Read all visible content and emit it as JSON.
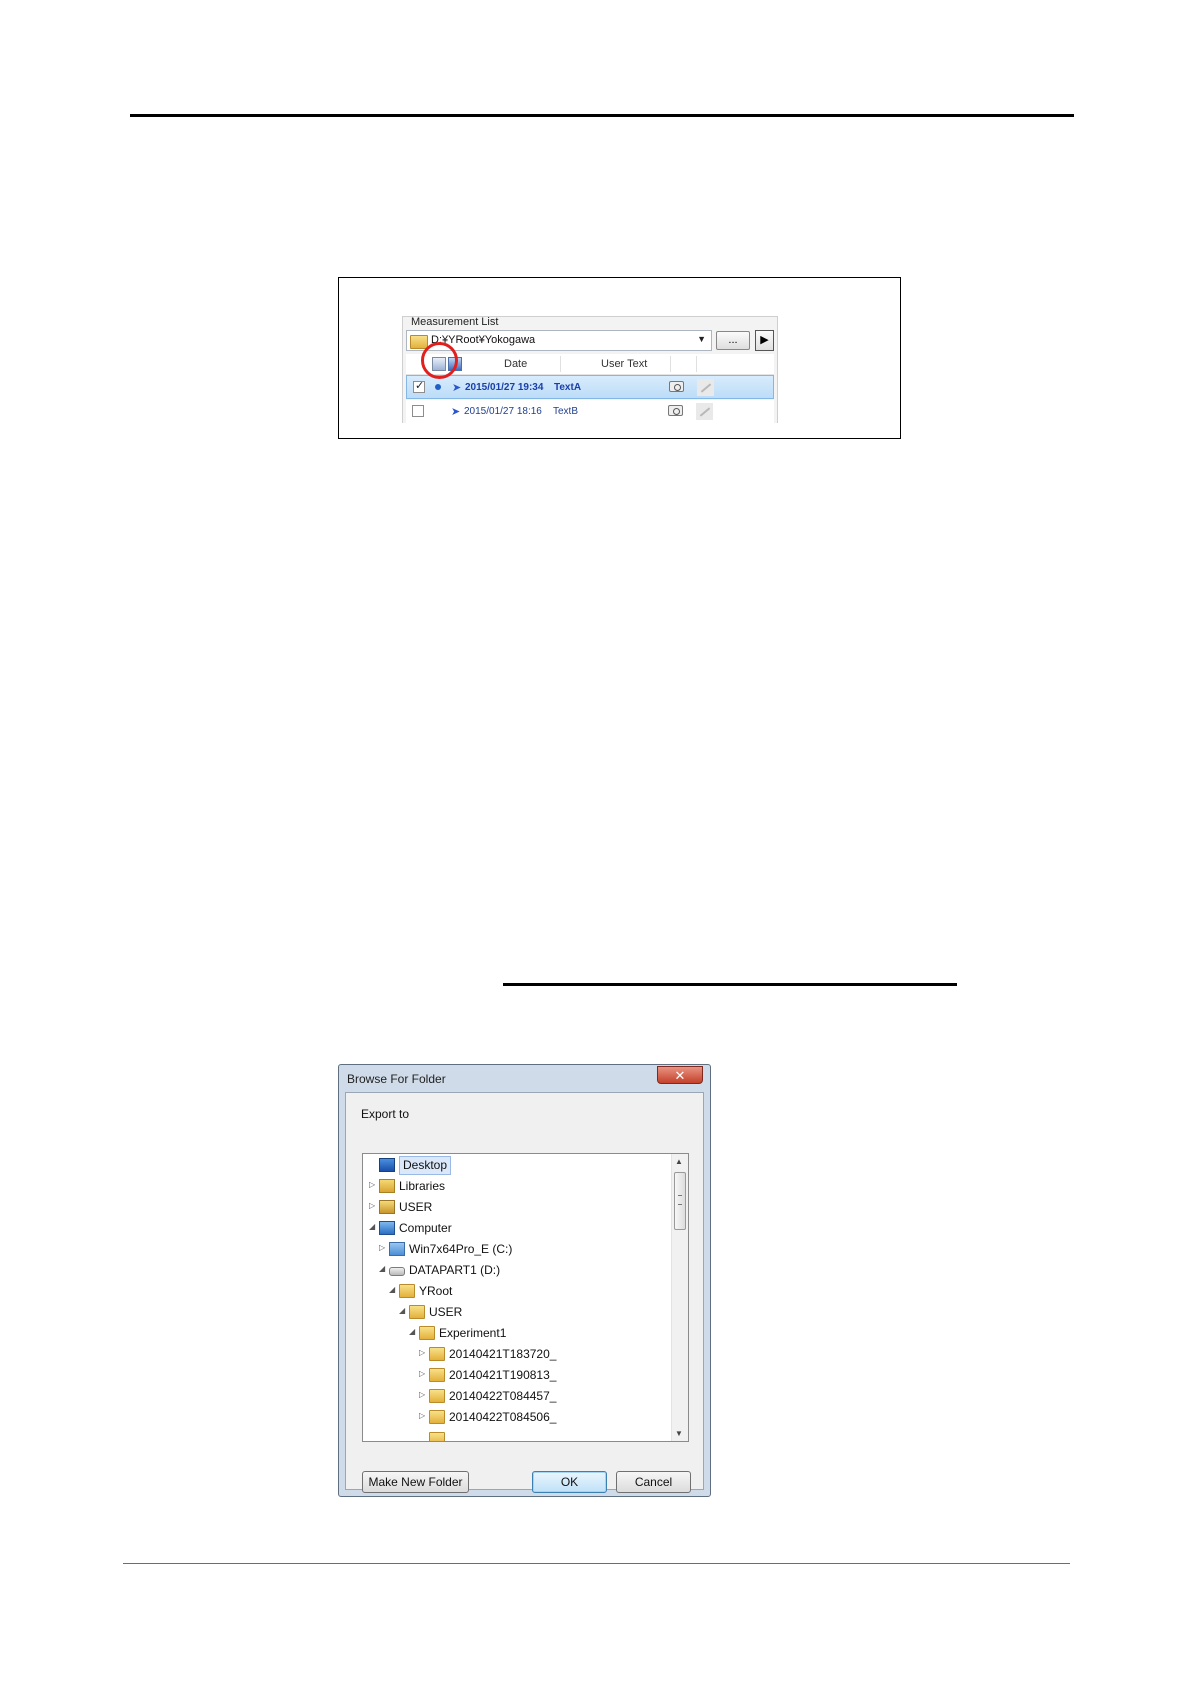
{
  "figure1": {
    "caption": "Measurement List",
    "path": "D:¥YRoot¥Yokogawa",
    "browse_label": "...",
    "play_label": "▶",
    "headers": {
      "date": "Date",
      "user_text": "User Text"
    },
    "rows": [
      {
        "date": "2015/01/27 19:34",
        "text": "TextA",
        "checked": true,
        "selected": true
      },
      {
        "date": "2015/01/27 18:16",
        "text": "TextB",
        "checked": false,
        "selected": false
      }
    ],
    "highlight_color": "#e0201f"
  },
  "dialog": {
    "title": "Browse For Folder",
    "close_label": "✕",
    "prompt": "Export to",
    "tree": [
      {
        "label": "Desktop",
        "icon": "desktop-icon",
        "expander": ""
      },
      {
        "label": "Libraries",
        "icon": "libraries-icon",
        "expander": "▷"
      },
      {
        "label": "USER",
        "icon": "user-icon",
        "expander": "▷"
      },
      {
        "label": "Computer",
        "icon": "computer-icon",
        "expander": "◢"
      },
      {
        "label": "Win7x64Pro_E (C:)",
        "icon": "drive-c-icon",
        "expander": "▷"
      },
      {
        "label": "DATAPART1 (D:)",
        "icon": "drive-d-icon",
        "expander": "◢"
      },
      {
        "label": "YRoot",
        "icon": "folder-icon",
        "expander": "◢"
      },
      {
        "label": "USER",
        "icon": "folder-icon",
        "expander": "◢"
      },
      {
        "label": "Experiment1",
        "icon": "folder-icon",
        "expander": "◢"
      },
      {
        "label": "20140421T183720_",
        "icon": "folder-icon",
        "expander": "▷"
      },
      {
        "label": "20140421T190813_",
        "icon": "folder-icon",
        "expander": "▷"
      },
      {
        "label": "20140422T084457_",
        "icon": "folder-icon",
        "expander": "▷"
      },
      {
        "label": "20140422T084506_",
        "icon": "folder-icon",
        "expander": "▷"
      }
    ],
    "buttons": {
      "make_new_folder": "Make New Folder",
      "ok": "OK",
      "cancel": "Cancel"
    }
  }
}
